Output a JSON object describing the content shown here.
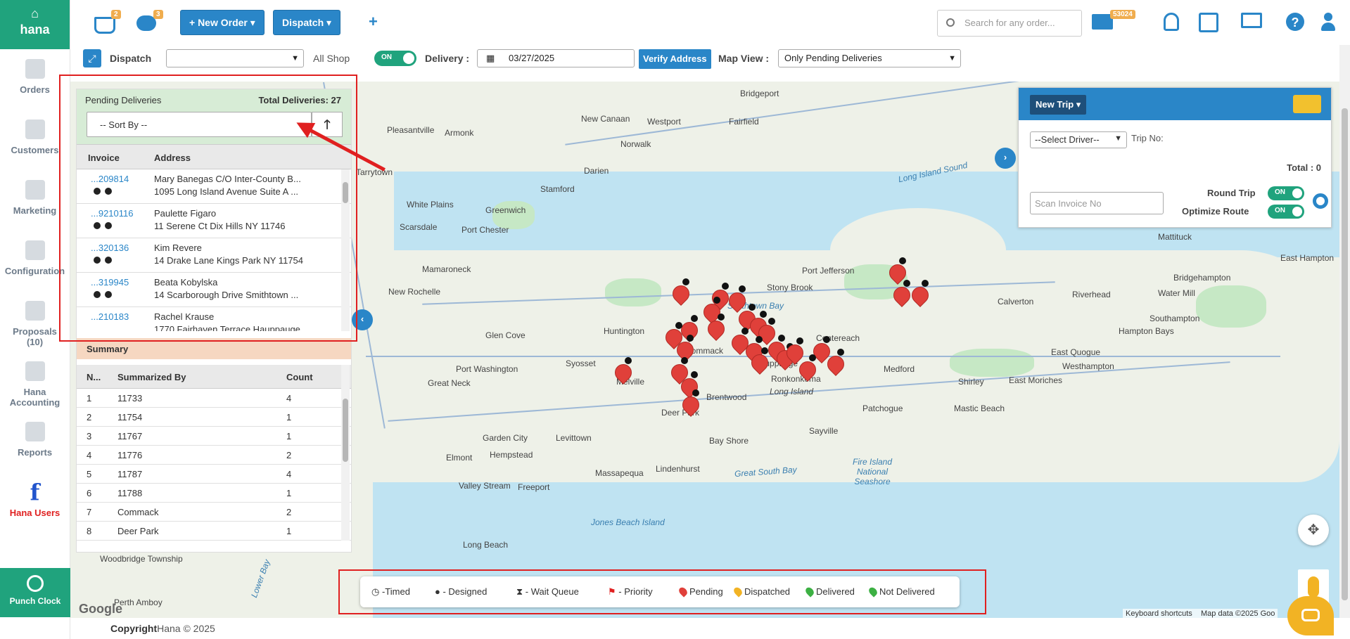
{
  "brand": {
    "name": "hana"
  },
  "nav": [
    {
      "label": "Orders"
    },
    {
      "label": "Customers"
    },
    {
      "label": "Marketing"
    },
    {
      "label": "Configuration"
    },
    {
      "label": "Proposals",
      "count": "(10)"
    },
    {
      "label": "Hana",
      "label2": "Accounting"
    },
    {
      "label": "Reports"
    },
    {
      "label": "Hana Users"
    }
  ],
  "punch_clock": "Punch Clock",
  "top": {
    "cart_badge": "2",
    "chat_badge": "3",
    "new_order": "+ New Order ▾",
    "dispatch": "Dispatch ▾",
    "plus": "+",
    "search_placeholder": "Search for any order...",
    "mail_badge": "53024",
    "help": "?"
  },
  "filters": {
    "title": "Dispatch",
    "shop_value": "",
    "all_shop": "All Shop",
    "toggle": "ON",
    "delivery_label": "Delivery :",
    "date": "03/27/2025",
    "verify": "Verify Address",
    "map_view_label": "Map View :",
    "map_view_value": "Only Pending Deliveries"
  },
  "pending": {
    "title": "Pending Deliveries",
    "total": "Total Deliveries: 27",
    "sort_placeholder": "-- Sort By --",
    "sort_dir": "🡑",
    "columns": [
      "Invoice",
      "Address"
    ],
    "rows": [
      {
        "invoice": "...209814",
        "name": "Mary Banegas C/O Inter-County B...",
        "address": "1095 Long Island Avenue Suite A ..."
      },
      {
        "invoice": "...9210116",
        "name": "Paulette Figaro",
        "address": "11 Serene Ct Dix Hills NY 11746"
      },
      {
        "invoice": "...320136",
        "name": "Kim Revere",
        "address": "14 Drake Lane Kings Park NY 11754"
      },
      {
        "invoice": "...319945",
        "name": "Beata Kobylska",
        "address": "14 Scarborough Drive Smithtown ..."
      },
      {
        "invoice": "...210183",
        "name": "Rachel Krause",
        "address": "1770 Fairhaven Terrace Hauppauge"
      }
    ]
  },
  "summary": {
    "title": "Summary",
    "columns": [
      "N...",
      "Summarized By",
      "Count"
    ],
    "rows": [
      {
        "n": "1",
        "by": "11733",
        "count": "4"
      },
      {
        "n": "2",
        "by": "11754",
        "count": "1"
      },
      {
        "n": "3",
        "by": "11767",
        "count": "1"
      },
      {
        "n": "4",
        "by": "11776",
        "count": "2"
      },
      {
        "n": "5",
        "by": "11787",
        "count": "4"
      },
      {
        "n": "6",
        "by": "11788",
        "count": "1"
      },
      {
        "n": "7",
        "by": "Commack",
        "count": "2"
      },
      {
        "n": "8",
        "by": "Deer Park",
        "count": "1"
      }
    ]
  },
  "trip": {
    "new_trip": "New Trip ▾",
    "driver": "--Select Driver--",
    "trip_no": "Trip No:",
    "total": "Total : 0",
    "scan_placeholder": "Scan Invoice No",
    "round_trip": "Round Trip",
    "optimize": "Optimize Route",
    "on": "ON"
  },
  "map_labels": [
    "Bridgeport",
    "New Canaan",
    "Westport",
    "Fairfield",
    "Pleasantville",
    "Armonk",
    "Norwalk",
    "Darien",
    "Tarrytown",
    "Stamford",
    "White Plains",
    "Greenwich",
    "Scarsdale",
    "Port Chester",
    "Mamaroneck",
    "New Rochelle",
    "Glen Cove",
    "Huntington",
    "Port Washington",
    "Syosset",
    "Great Neck",
    "Commack",
    "Hauppauge",
    "Stony Brook",
    "Centereach",
    "Brentwood",
    "Deer Park",
    "Ronkonkoma",
    "Long Island",
    "Medford",
    "Calverton",
    "Riverhead",
    "Mattituck",
    "Bridgehampton",
    "Water Mill",
    "Southampton",
    "Hampton Bays",
    "East Quogue",
    "Westhampton",
    "Shirley",
    "East Moriches",
    "Mastic Beach",
    "Patchogue",
    "Sayville",
    "Bay Shore",
    "Garden City",
    "Hempstead",
    "Levittown",
    "Elmont",
    "Massapequa",
    "Lindenhurst",
    "Valley Stream",
    "Freeport",
    "Long Beach",
    "Woodbridge Township",
    "Perth Amboy",
    "Melville",
    "Port Jefferson",
    "East Hampton"
  ],
  "water_labels": [
    "Long Island Sound",
    "Smithtown Bay",
    "Great South Bay",
    "Jones Beach Island",
    "Fire Island National Seashore",
    "Lower Bay"
  ],
  "legend": {
    "timed": "-Timed",
    "designed": "- Designed",
    "wait": "- Wait Queue",
    "priority": "- Priority",
    "pending": "Pending",
    "dispatched": "Dispatched",
    "delivered": "Delivered",
    "not_delivered": "Not Delivered"
  },
  "colors": {
    "accent": "#2a86c8",
    "brand": "#20a37d",
    "pending": "#e0403a",
    "dispatched": "#f2b324",
    "delivered": "#3cb043"
  },
  "map_footer": {
    "google": "Google",
    "shortcuts": "Keyboard shortcuts",
    "data": "Map data ©2025 Goo"
  },
  "footer": {
    "copyright": "Copyright",
    "text": "Hana © 2025"
  }
}
